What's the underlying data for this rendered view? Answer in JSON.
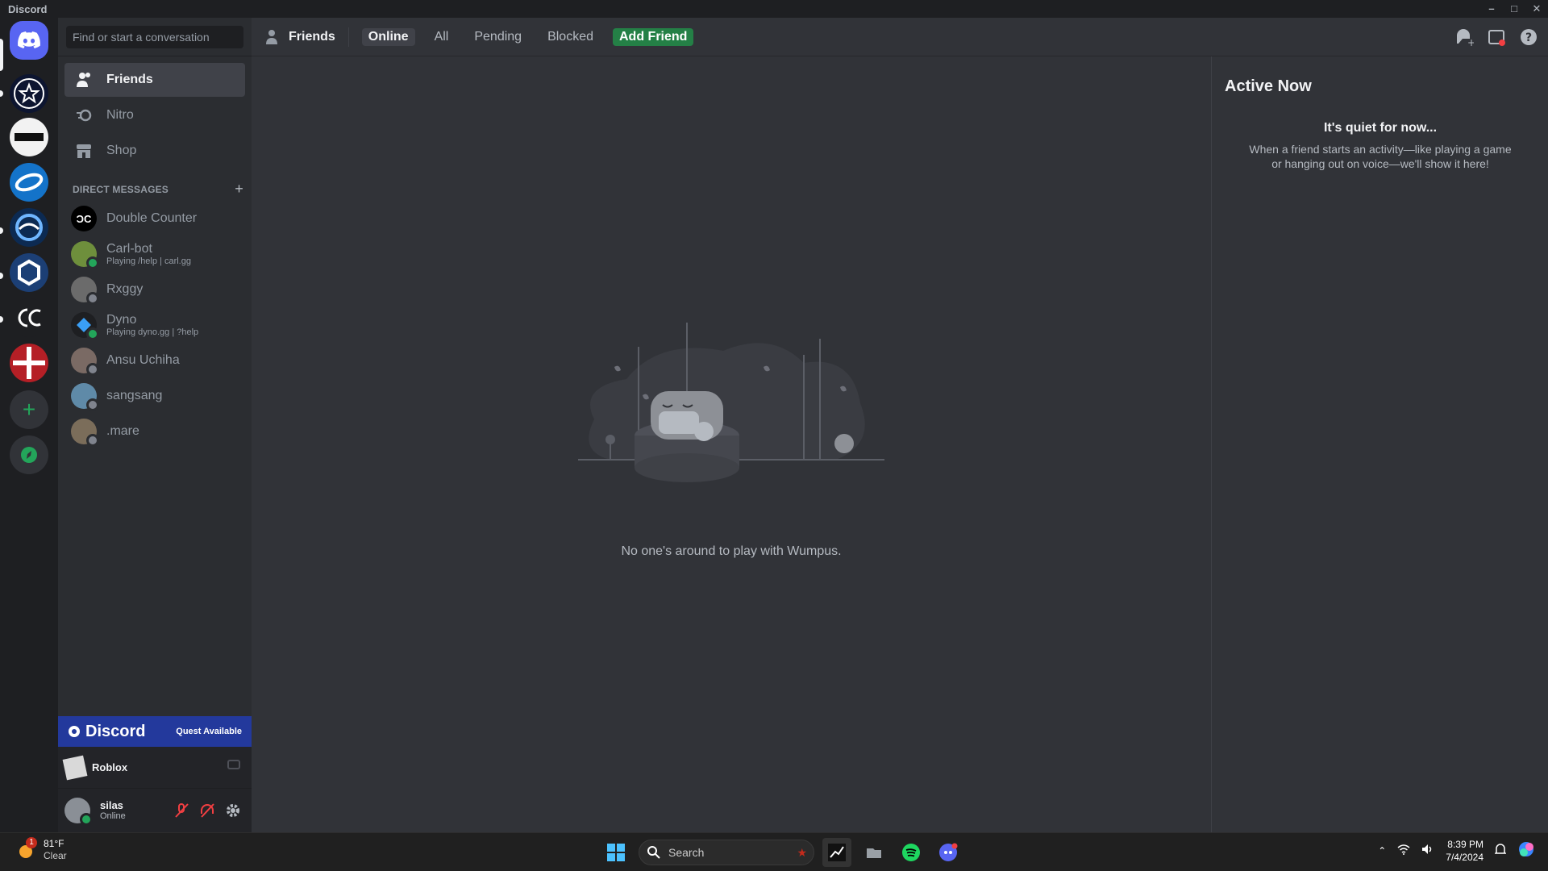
{
  "window": {
    "title": "Discord"
  },
  "sidebar": {
    "search_placeholder": "Find or start a conversation",
    "nav": [
      {
        "label": "Friends"
      },
      {
        "label": "Nitro"
      },
      {
        "label": "Shop"
      }
    ],
    "dm_header": "DIRECT MESSAGES",
    "dms": [
      {
        "name": "Double Counter",
        "sub": ""
      },
      {
        "name": "Carl-bot",
        "sub": "Playing /help | carl.gg"
      },
      {
        "name": "Rxggy",
        "sub": ""
      },
      {
        "name": "Dyno",
        "sub": "Playing dyno.gg | ?help"
      },
      {
        "name": "Ansu Uchiha",
        "sub": ""
      },
      {
        "name": "sangsang",
        "sub": ""
      },
      {
        "name": ".mare",
        "sub": ""
      }
    ],
    "quest": {
      "brand": "Discord",
      "label": "Quest Available"
    },
    "activity": {
      "name": "Roblox"
    },
    "user": {
      "name": "silas",
      "status": "Online"
    }
  },
  "header": {
    "title": "Friends",
    "tabs": [
      {
        "label": "Online"
      },
      {
        "label": "All"
      },
      {
        "label": "Pending"
      },
      {
        "label": "Blocked"
      },
      {
        "label": "Add Friend"
      }
    ]
  },
  "main": {
    "empty_text": "No one's around to play with Wumpus."
  },
  "active_now": {
    "title": "Active Now",
    "quiet": "It's quiet for now...",
    "desc": "When a friend starts an activity—like playing a game or hanging out on voice—we'll show it here!"
  },
  "taskbar": {
    "weather_badge": "1",
    "temp": "81°F",
    "condition": "Clear",
    "search": "Search",
    "time": "8:39 PM",
    "date": "7/4/2024"
  },
  "colors": {
    "online": "#23a55a",
    "offline": "#80848e",
    "blurple": "#5865f2",
    "add_friend": "#248046"
  }
}
